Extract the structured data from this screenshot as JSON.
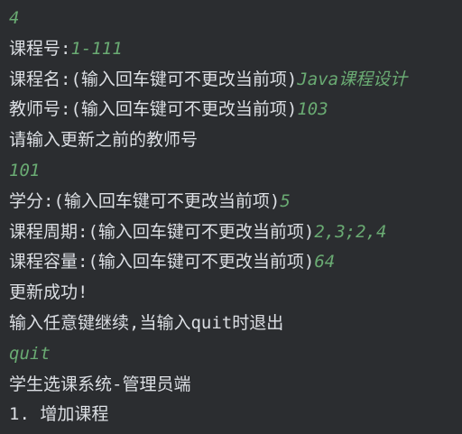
{
  "console": {
    "lines": [
      {
        "prompt": "",
        "input": "4"
      },
      {
        "prompt": "课程号:",
        "input": "1-111"
      },
      {
        "prompt": "课程名:(输入回车键可不更改当前项)",
        "input": "Java课程设计"
      },
      {
        "prompt": "教师号:(输入回车键可不更改当前项)",
        "input": "103"
      },
      {
        "prompt": "请输入更新之前的教师号",
        "input": ""
      },
      {
        "prompt": "",
        "input": "101"
      },
      {
        "prompt": "学分:(输入回车键可不更改当前项)",
        "input": "5"
      },
      {
        "prompt": "课程周期:(输入回车键可不更改当前项)",
        "input": "2,3;2,4"
      },
      {
        "prompt": "课程容量:(输入回车键可不更改当前项)",
        "input": "64"
      },
      {
        "prompt": "更新成功!",
        "input": ""
      },
      {
        "prompt": "输入任意键继续,当输入quit时退出",
        "input": ""
      },
      {
        "prompt": "",
        "input": "quit"
      },
      {
        "prompt": "学生选课系统-管理员端",
        "input": ""
      },
      {
        "prompt": "1. 增加课程",
        "input": ""
      }
    ]
  },
  "colors": {
    "background": "#2b2d30",
    "output_text": "#dcdfe4",
    "user_input": "#6aab73"
  }
}
